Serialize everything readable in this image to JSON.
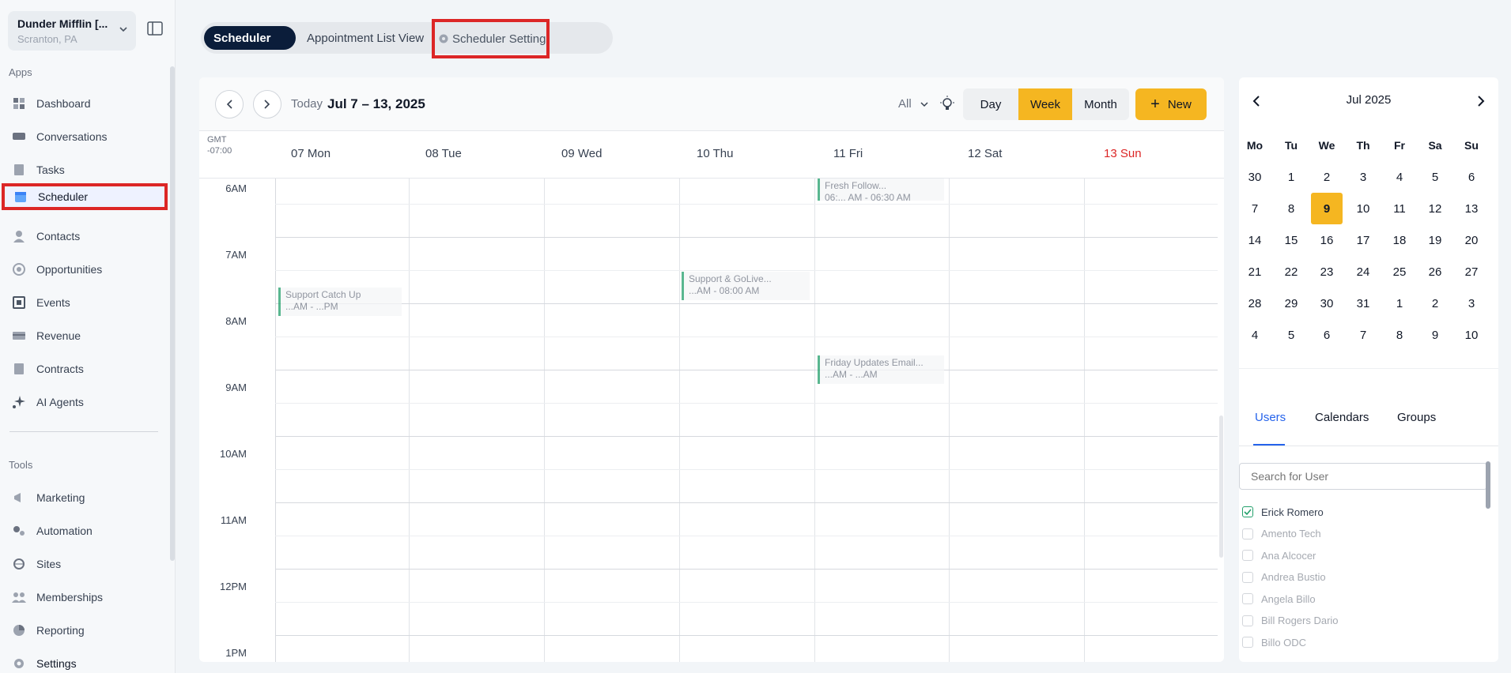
{
  "account": {
    "name": "Dunder Mifflin [...",
    "location": "Scranton, PA"
  },
  "sidebar": {
    "apps_title": "Apps",
    "apps": [
      {
        "label": "Dashboard",
        "icon": "dashboard-icon"
      },
      {
        "label": "Conversations",
        "icon": "chat-icon"
      },
      {
        "label": "Tasks",
        "icon": "clipboard-icon"
      },
      {
        "label": "Scheduler",
        "icon": "calendar-icon",
        "active": true
      },
      {
        "label": "Contacts",
        "icon": "person-icon"
      },
      {
        "label": "Opportunities",
        "icon": "target-icon"
      },
      {
        "label": "Events",
        "icon": "events-icon"
      },
      {
        "label": "Revenue",
        "icon": "card-icon"
      },
      {
        "label": "Contracts",
        "icon": "document-icon"
      },
      {
        "label": "AI Agents",
        "icon": "sparkle-icon"
      }
    ],
    "tools_title": "Tools",
    "tools": [
      {
        "label": "Marketing",
        "icon": "megaphone-icon"
      },
      {
        "label": "Automation",
        "icon": "gears-icon"
      },
      {
        "label": "Sites",
        "icon": "globe-icon"
      },
      {
        "label": "Memberships",
        "icon": "people-icon"
      },
      {
        "label": "Reporting",
        "icon": "pie-icon"
      },
      {
        "label": "Settings",
        "icon": "gear-icon"
      }
    ]
  },
  "top_tabs": {
    "scheduler": "Scheduler",
    "list": "Appointment List View",
    "setting": "Scheduler Setting"
  },
  "toolbar": {
    "today": "Today",
    "range": "Jul 7 – 13, 2025",
    "filter": "All",
    "views": {
      "day": "Day",
      "week": "Week",
      "month": "Month"
    },
    "new": "New"
  },
  "week": {
    "gmt_top": "GMT",
    "gmt_bottom": "-07:00",
    "days": [
      "07 Mon",
      "08 Tue",
      "09 Wed",
      "10 Thu",
      "11 Fri",
      "12 Sat",
      "13 Sun"
    ],
    "times": [
      "6AM",
      "7AM",
      "8AM",
      "9AM",
      "10AM",
      "11AM",
      "12PM",
      "1PM"
    ],
    "events": [
      {
        "title": "Support Catch Up",
        "sub": "...AM - ...PM"
      },
      {
        "title": "Support & GoLive...",
        "sub": "...AM - 08:00 AM"
      },
      {
        "title": "Friday Updates Email...",
        "sub": "...AM - ...AM"
      },
      {
        "title": "Fresh Follow...",
        "sub": "06:... AM - 06:30 AM"
      }
    ]
  },
  "mini_calendar": {
    "title": "Jul 2025",
    "weekdays": [
      "Mo",
      "Tu",
      "We",
      "Th",
      "Fr",
      "Sa",
      "Su"
    ],
    "weeks": [
      [
        "30",
        "1",
        "2",
        "3",
        "4",
        "5",
        "6"
      ],
      [
        "7",
        "8",
        "9",
        "10",
        "11",
        "12",
        "13"
      ],
      [
        "14",
        "15",
        "16",
        "17",
        "18",
        "19",
        "20"
      ],
      [
        "21",
        "22",
        "23",
        "24",
        "25",
        "26",
        "27"
      ],
      [
        "28",
        "29",
        "30",
        "31",
        "1",
        "2",
        "3"
      ],
      [
        "4",
        "5",
        "6",
        "7",
        "8",
        "9",
        "10"
      ]
    ],
    "selected": "9"
  },
  "side_tabs": [
    "Users",
    "Calendars",
    "Groups"
  ],
  "user_search_placeholder": "Search for User",
  "users": [
    {
      "name": "Erick Romero",
      "checked": true
    },
    {
      "name": "Amento Tech",
      "checked": false
    },
    {
      "name": "Ana Alcocer",
      "checked": false
    },
    {
      "name": "Andrea Bustio",
      "checked": false
    },
    {
      "name": "Angela Billo",
      "checked": false
    },
    {
      "name": "Bill Rogers Dario",
      "checked": false
    },
    {
      "name": "Billo ODC",
      "checked": false
    }
  ],
  "colors": {
    "accent": "#f5b621",
    "navy": "#0b1d3a",
    "highlight": "#dc2626",
    "link": "#2563eb",
    "event": "#22a06b"
  }
}
